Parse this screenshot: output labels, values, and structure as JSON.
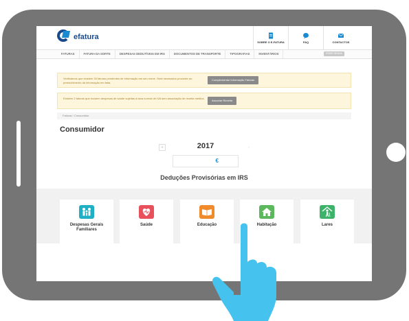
{
  "app": {
    "logo_text": "efatura"
  },
  "top_actions": [
    {
      "label": "SOBRE O E-FATURA",
      "icon": "document-icon"
    },
    {
      "label": "FAQ",
      "icon": "chat-bubble-icon"
    },
    {
      "label": "CONTACTOS",
      "icon": "envelope-icon"
    }
  ],
  "nav": {
    "items": [
      "FATURAS",
      "FATURA DA SORTE",
      "DESPESAS DEDUTÍVEIS EM IRS",
      "DOCUMENTOS DE TRANSPORTE",
      "TIPOGRAFIAS",
      "INVENTÁRIOS"
    ],
    "right_button": "PEDIR SENHA"
  },
  "alerts": [
    {
      "text": "Verificámos que existem 30 faturas pendentes de informação em seu nome. Será necessário proceder ao preenchimento da informação em falta.",
      "button": "Complementar Informação Faturas"
    },
    {
      "text": "Existem 2 faturas que incluem despesas de saúde sujeitas à taxa normal de IVA sem associação de receita médica.",
      "button": "Associar Receita"
    }
  ],
  "breadcrumb": "Faturas / Consumidor",
  "page_title": "Consumidor",
  "year": {
    "value": "2017",
    "prev": "‹",
    "next": "›"
  },
  "total_currency": "€",
  "section_title": "Deduções Provisórias em IRS",
  "categories": [
    {
      "label": "Despesas Gerais Familiares",
      "icon": "family-icon",
      "color": "#1fb0c6"
    },
    {
      "label": "Saúde",
      "icon": "heart-icon",
      "color": "#e8505b"
    },
    {
      "label": "Educação",
      "icon": "book-icon",
      "color": "#f08a2a"
    },
    {
      "label": "Habitação",
      "icon": "house-icon",
      "color": "#5cb85c"
    },
    {
      "label": "Lares",
      "icon": "elder-person-icon",
      "color": "#3db36a"
    }
  ],
  "colors": {
    "tablet": "#757575",
    "accent": "#1a8bd0",
    "hand": "#45c3ee",
    "alert_bg": "#fdf6dc"
  }
}
